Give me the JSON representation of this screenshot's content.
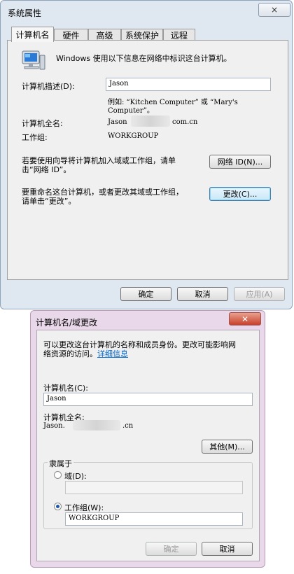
{
  "sys_props": {
    "title": "系统属性",
    "close_glyph": "×",
    "tabs": [
      "计算机名",
      "硬件",
      "高级",
      "系统保护",
      "远程"
    ],
    "intro": "Windows 使用以下信息在网络中标识这台计算机。",
    "desc_label": "计算机描述(D):",
    "desc_value": "Jason",
    "example": "例如: “Kitchen Computer” 或 “Mary's",
    "example2": "Computer”。",
    "fullname_label": "计算机全名:",
    "fullname_prefix": "Jason",
    "fullname_suffix": "com.cn",
    "workgroup_label": "工作组:",
    "workgroup_value": "WORKGROUP",
    "wizard_text1": "若要使用向导将计算机加入域或工作组，请单",
    "wizard_text2": "击“网络 ID”。",
    "network_id_btn": "网络 ID(N)...",
    "rename_text1": "要重命名这台计算机，或者更改其域或工作组，",
    "rename_text2": "请单击“更改”。",
    "change_btn": "更改(C)...",
    "ok_btn": "确定",
    "cancel_btn": "取消",
    "apply_btn": "应用(A)"
  },
  "name_dialog": {
    "title": "计算机名/域更改",
    "close_glyph": "✕",
    "info1": "可以更改这台计算机的名称和成员身份。更改可能影响网",
    "info2_text": "络资源的访问。",
    "info2_link": "详细信息",
    "name_label": "计算机名(C):",
    "name_value": "Jason",
    "fullname_label": "计算机全名:",
    "fullname_prefix": "Jason.",
    "fullname_suffix": ".cn",
    "more_btn": "其他(M)...",
    "member_of_label": "隶属于",
    "domain_label": "域(D):",
    "domain_value": "",
    "workgroup_label": "工作组(W):",
    "workgroup_value": "WORKGROUP",
    "selected_option": "workgroup",
    "ok_btn": "确定",
    "cancel_btn": "取消"
  },
  "icons": {
    "computer": "computer-icon"
  }
}
